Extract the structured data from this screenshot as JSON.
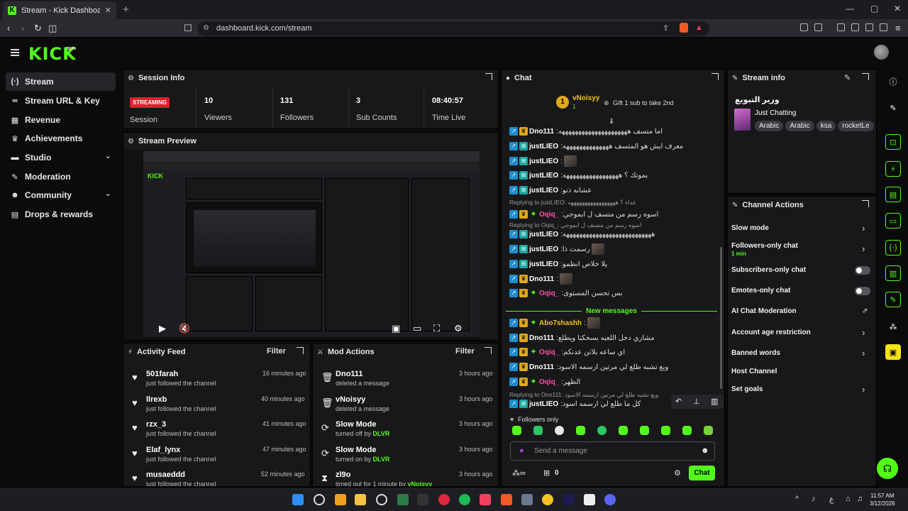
{
  "browser": {
    "tab_title": "Stream - Kick Dashboard",
    "tab_close": "✕",
    "new_tab": "+",
    "url": "dashboard.kick.com/stream",
    "window_controls": [
      "—",
      "▢",
      "✕"
    ]
  },
  "brand": {
    "logo": "KICK",
    "beta": "BETA",
    "accent": "#53fc18"
  },
  "sidebar": {
    "items": [
      {
        "label": "Stream",
        "icon": "broadcast-icon",
        "glyph": "((·))"
      },
      {
        "label": "Stream URL & Key",
        "icon": "link-icon",
        "glyph": "🔗"
      },
      {
        "label": "Revenue",
        "icon": "chart-icon",
        "glyph": "▮"
      },
      {
        "label": "Achievements",
        "icon": "trophy-icon",
        "glyph": "🏆"
      },
      {
        "label": "Studio",
        "icon": "video-icon",
        "glyph": "▬"
      },
      {
        "label": "Moderation",
        "icon": "wrench-icon",
        "glyph": "🔧"
      },
      {
        "label": "Community",
        "icon": "people-icon",
        "glyph": "👥"
      },
      {
        "label": "Drops & rewards",
        "icon": "gift-icon",
        "glyph": "⊞"
      }
    ],
    "chevron": "⌄"
  },
  "session": {
    "title": "Session Info",
    "status": "STREAMING",
    "status_label": "Session",
    "stats": [
      {
        "value": "10",
        "label": "Viewers"
      },
      {
        "value": "131",
        "label": "Followers"
      },
      {
        "value": "3",
        "label": "Sub Counts"
      },
      {
        "value": "08:40:57",
        "label": "Time Live"
      }
    ]
  },
  "preview": {
    "title": "Stream Preview"
  },
  "activity": {
    "title": "Activity Feed",
    "filter": "Filter",
    "rows": [
      {
        "name": "501farah",
        "sub": "just followed the channel",
        "time": "16 minutes ago"
      },
      {
        "name": "llrexb",
        "sub": "just followed the channel",
        "time": "40 minutes ago"
      },
      {
        "name": "rzx_3",
        "sub": "just followed the channel",
        "time": "41 minutes ago"
      },
      {
        "name": "Elaf_lynx",
        "sub": "just followed the channel",
        "time": "47 minutes ago"
      },
      {
        "name": "musaeddd",
        "sub": "just followed the channel",
        "time": "52 minutes ago"
      }
    ]
  },
  "modactions": {
    "title": "Mod Actions",
    "filter": "Filter",
    "rows": [
      {
        "name": "Dno111",
        "sub": "deleted a message",
        "by": "",
        "time": "3 hours ago",
        "glyph": "🗑"
      },
      {
        "name": "vNoisyy",
        "sub": "deleted a message",
        "by": "",
        "time": "3 hours ago",
        "glyph": "🗑"
      },
      {
        "name": "Slow Mode",
        "sub": "turned off by",
        "by": "DLVR",
        "time": "3 hours ago",
        "glyph": "⟳"
      },
      {
        "name": "Slow Mode",
        "sub": "turned on by",
        "by": "DLVR",
        "time": "3 hours ago",
        "glyph": "⟳"
      },
      {
        "name": "zl9o",
        "sub": "timed out for 1 minute by",
        "by": "vNoisyy",
        "time": "3 hours ago",
        "glyph": "⧗"
      }
    ]
  },
  "chat": {
    "title": "Chat",
    "top_user": "vNoisyy",
    "top_count": "1",
    "gift_text": "Gift 1 sub to take 2nd",
    "new_messages": "New messages",
    "messages": [
      {
        "user": "Dno111",
        "color": "#ffffff",
        "badge": "crown",
        "text": "اما متسف هههههههههههههههههههههه"
      },
      {
        "user": "justLIEO",
        "color": "#ffffff",
        "badge": "mod",
        "text": "معرف ايش هو المتسف ههههههههههههههه"
      },
      {
        "user": "justLIEO",
        "color": "#ffffff",
        "badge": "mod",
        "text": "",
        "thumb": true
      },
      {
        "user": "justLIEO",
        "color": "#ffffff",
        "badge": "mod",
        "text": "بموتك ؟ هههههههههههههههههه"
      },
      {
        "user": "justLIEO",
        "color": "#ffffff",
        "badge": "mod",
        "text": "عشانه ذنو"
      },
      {
        "user": "Oqiq_",
        "color": "#ff4fa3",
        "badge": "vip",
        "text": "اسوه رسم من متسف ل ابموجي"
      },
      {
        "user": "justLIEO",
        "color": "#ffffff",
        "badge": "mod",
        "text": "هههههههههههههههههههههههههههه"
      },
      {
        "user": "justLIEO",
        "color": "#ffffff",
        "badge": "mod",
        "text": "رسمت ذا",
        "thumb": true
      },
      {
        "user": "justLIEO",
        "color": "#ffffff",
        "badge": "mod",
        "text": "يلا خلاص انظمو"
      },
      {
        "user": "Dno111",
        "color": "#ffffff",
        "badge": "crown",
        "text": "",
        "thumb": true
      },
      {
        "user": "Oqiq_",
        "color": "#ff4fa3",
        "badge": "vip",
        "text": "بس تحسن المستوى"
      },
      {
        "user": "Abo7shashh",
        "color": "#f0c419",
        "badge": "vip",
        "text": "",
        "thumb": true
      },
      {
        "user": "Dno111",
        "color": "#ffffff",
        "badge": "crown",
        "text": "مشاري دخل اللعبه بسحكنا ويطلع"
      },
      {
        "user": "Oqiq_",
        "color": "#ff4fa3",
        "badge": "vip",
        "text": "اي ساعه بلاتن عدنكم"
      },
      {
        "user": "Dno111",
        "color": "#ffffff",
        "badge": "crown",
        "text": "ويع تشبه طلع لي مرتين ارسمه الاسود"
      },
      {
        "user": "Oqiq_",
        "color": "#ff4fa3",
        "badge": "vip",
        "text": "الظهر"
      },
      {
        "user": "justLIEO",
        "color": "#ffffff",
        "badge": "mod",
        "text": "كل ما طلع لي ارسمه اسود"
      }
    ],
    "replies": [
      "Replying to justLIEO: عداء ؟ هههههههههههههههههه",
      "Replying to Oqiq_: اسوه رسم من متسف ل ابموجي",
      "Replying to Dno111: ويع تشبه طلع لي مرتين ارسمه الاسود"
    ],
    "followers_only": "Followers only",
    "placeholder": "Send a message",
    "count": "0",
    "chat_button": "Chat"
  },
  "streaminfo": {
    "title": "Stream info",
    "stream_title": "وزير التبويع",
    "category": "Just Chatting",
    "tags": [
      "Arabic",
      "Arabic",
      "ksa",
      "rocketLe"
    ]
  },
  "actions": {
    "title": "Channel Actions",
    "items": [
      {
        "label": "Slow mode",
        "control": "chevron",
        "sub": ""
      },
      {
        "label": "Followers-only chat",
        "control": "chevron",
        "sub": "1 min"
      },
      {
        "label": "Subscribers-only chat",
        "control": "toggle",
        "sub": ""
      },
      {
        "label": "Emotes-only chat",
        "control": "toggle",
        "sub": ""
      },
      {
        "label": "AI Chat Moderation",
        "control": "external",
        "sub": ""
      },
      {
        "label": "Account age restriction",
        "control": "chevron",
        "sub": ""
      },
      {
        "label": "Banned words",
        "control": "chevron",
        "sub": ""
      },
      {
        "label": "Host Channel",
        "control": "none",
        "sub": ""
      },
      {
        "label": "Set goals",
        "control": "chevron",
        "sub": ""
      }
    ]
  },
  "taskbar": {
    "time": "11:57 AM",
    "date": "3/12/2026",
    "lang": "ع"
  }
}
